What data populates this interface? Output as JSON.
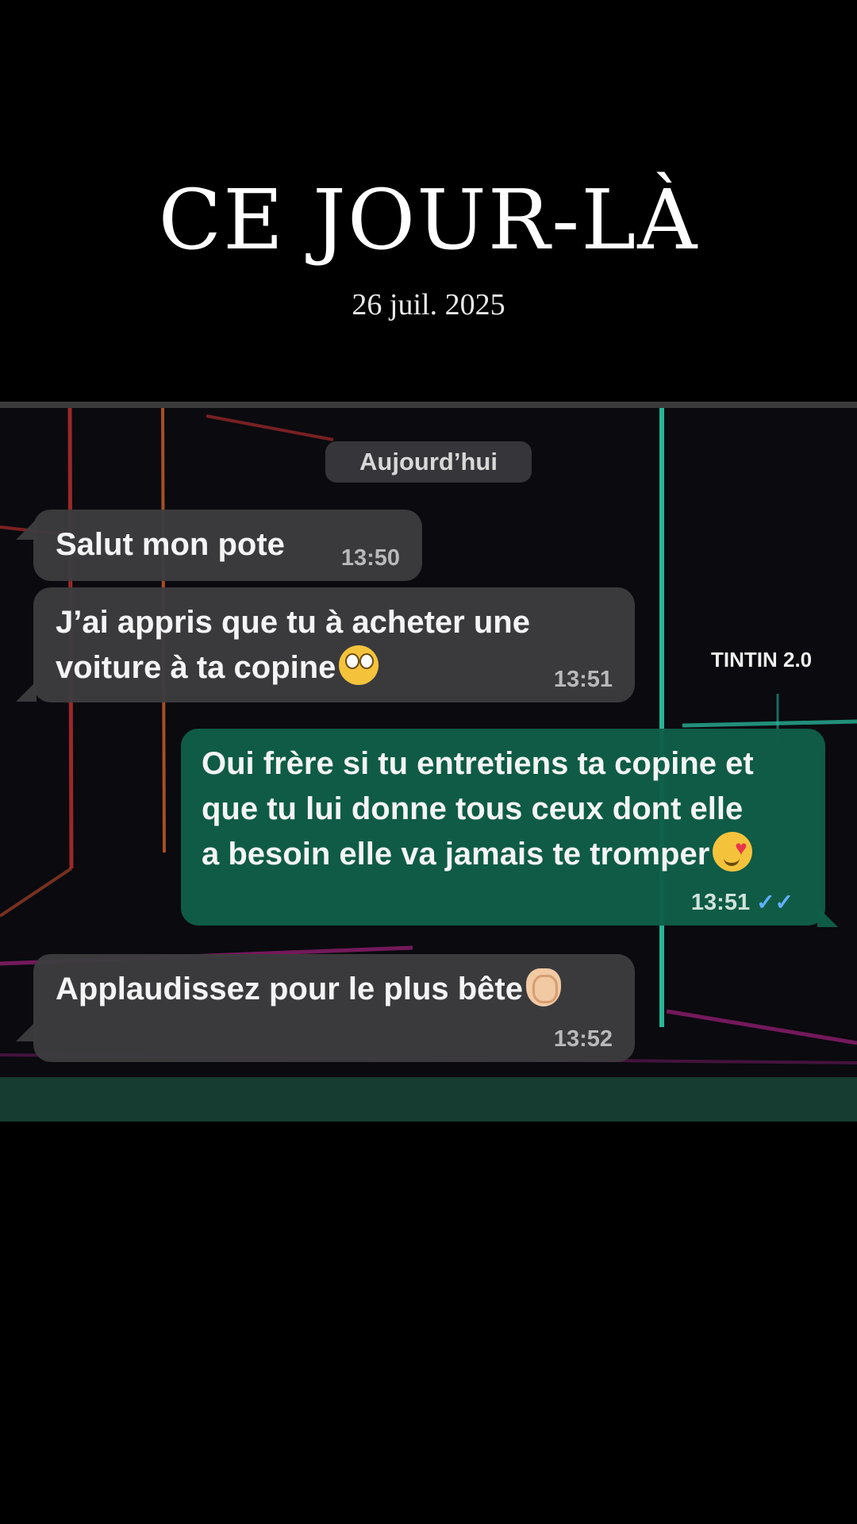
{
  "header": {
    "title": "CE JOUR-LÀ",
    "date": "26 juil. 2025"
  },
  "chat": {
    "day_label": "Aujourd’hui",
    "watermark": "TINTIN 2.0",
    "messages": [
      {
        "direction": "incoming",
        "text": "Salut mon pote",
        "time": "13:50",
        "emoji": ""
      },
      {
        "direction": "incoming",
        "text": "J’ai appris que tu à acheter une\nvoiture à ta copine",
        "time": "13:51",
        "emoji": "face-with-rolling-eyes-icon"
      },
      {
        "direction": "outgoing",
        "text": "Oui frère si tu entretiens ta copine et\nque tu lui donne tous ceux dont elle\na besoin elle va jamais te tromper",
        "time": "13:51",
        "emoji": "smiling-face-with-hearts-icon",
        "status": "read"
      },
      {
        "direction": "incoming",
        "text": "Applaudissez pour le plus bête",
        "time": "13:52",
        "emoji": "clapping-hands-icon"
      }
    ]
  },
  "colors": {
    "background": "#000000",
    "incoming_bubble": "#3c3c40",
    "outgoing_bubble": "#105e48",
    "read_ticks": "#5fb0ff"
  }
}
